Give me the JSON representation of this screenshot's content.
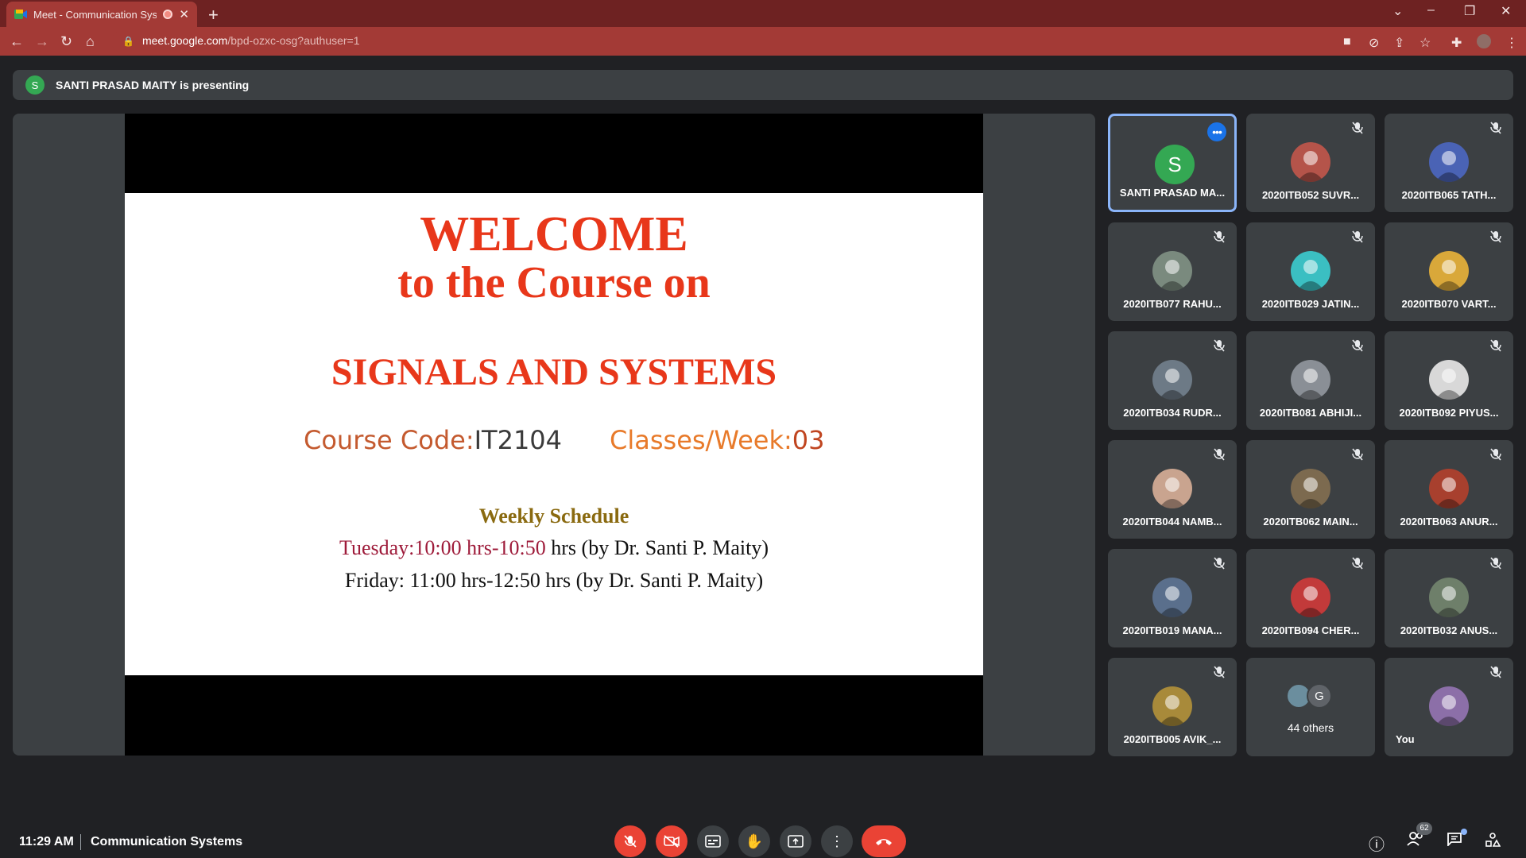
{
  "browser": {
    "tab_title": "Meet - Communication Syste",
    "url_host": "meet.google.com",
    "url_path": "/bpd-ozxc-osg?authuser=1"
  },
  "presenting": {
    "avatar_letter": "S",
    "text": "SANTI PRASAD MAITY is presenting"
  },
  "slide": {
    "welcome": "WELCOME",
    "course_on": "to the Course on",
    "subject": "SIGNALS AND SYSTEMS",
    "course_code_label": "Course Code:",
    "course_code_value": "IT2104",
    "classes_label": "Classes/Week:",
    "classes_value": "03",
    "weekly_heading": "Weekly Schedule",
    "tuesday_time": "Tuesday:10:00 hrs-10:50",
    "tuesday_rest": " hrs (by Dr. Santi P. Maity)",
    "friday": "Friday: 11:00 hrs-12:50 hrs (by Dr. Santi P. Maity)"
  },
  "participants": [
    {
      "name": "SANTI PRASAD MA...",
      "avatar": "S",
      "color": "#34a853"
    },
    {
      "name": "2020ITB052 SUVR...",
      "color": "#b5544a"
    },
    {
      "name": "2020ITB065 TATH...",
      "color": "#4a63b5"
    },
    {
      "name": "2020ITB077 RAHU...",
      "color": "#7a8a7e"
    },
    {
      "name": "2020ITB029 JATIN...",
      "color": "#3bbfc2"
    },
    {
      "name": "2020ITB070 VART...",
      "color": "#d9a83a"
    },
    {
      "name": "2020ITB034 RUDR...",
      "color": "#6d7a86"
    },
    {
      "name": "2020ITB081 ABHIJI...",
      "color": "#8a8f96"
    },
    {
      "name": "2020ITB092 PIYUS...",
      "color": "#d8d8d8"
    },
    {
      "name": "2020ITB044 NAMB...",
      "color": "#c9a48f"
    },
    {
      "name": "2020ITB062 MAIN...",
      "color": "#7c6a4f"
    },
    {
      "name": "2020ITB063 ANUR...",
      "color": "#a8402e"
    },
    {
      "name": "2020ITB019 MANA...",
      "color": "#5a6f8c"
    },
    {
      "name": "2020ITB094 CHER...",
      "color": "#c23a3a"
    },
    {
      "name": "2020ITB032 ANUS...",
      "color": "#6e7f6a"
    },
    {
      "name": "2020ITB005 AVIK_...",
      "color": "#a88a3a"
    }
  ],
  "others": {
    "label": "44 others",
    "second_letter": "G"
  },
  "you": {
    "label": "You",
    "color": "#8c6fa8"
  },
  "bottom": {
    "time": "11:29 AM",
    "meeting_name": "Communication Systems",
    "people_count": "62"
  }
}
